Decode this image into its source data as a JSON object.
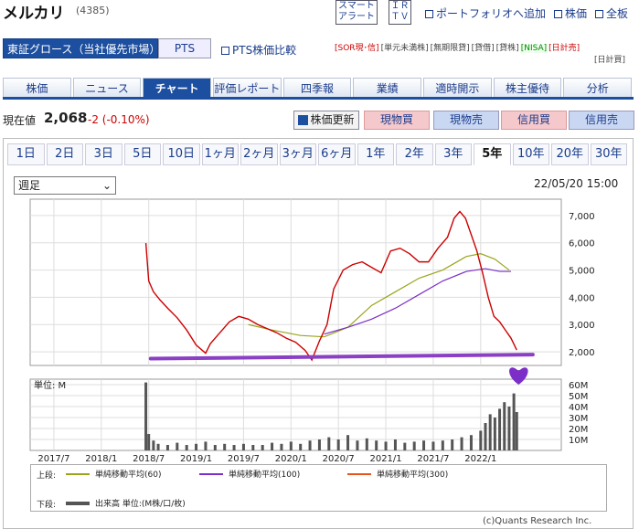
{
  "header": {
    "title": "メルカリ",
    "code": "(4385)",
    "alert_line1": "スマート",
    "alert_line2": "アラート",
    "ir_line1": "ＩＲ",
    "ir_line2": "ＴＶ",
    "links": [
      "ポートフォリオへ追加",
      "株価",
      "全板"
    ]
  },
  "market": {
    "name": "東証グロース（当社優先市場）",
    "pts": "PTS",
    "pts_compare": "PTS株価比較"
  },
  "tags": {
    "row1": [
      "[SOR現･信]",
      "[単元未満株]",
      "[無期限貸]",
      "[貸借]",
      "[貸株]",
      "[NISA]",
      "[日計売]"
    ],
    "row2": "[日計買]"
  },
  "tabs": [
    "株価",
    "ニュース",
    "チャート",
    "評価レポート",
    "四季報",
    "業績",
    "適時開示",
    "株主優待",
    "分析"
  ],
  "active_tab": "チャート",
  "price": {
    "label": "現在値",
    "value": "2,068",
    "change": "-2 (-0.10%)"
  },
  "buttons": {
    "update": "株価更新",
    "buy": "現物買",
    "sell": "現物売",
    "margin_buy": "信用買",
    "margin_sell": "信用売"
  },
  "periods": [
    "1日",
    "2日",
    "3日",
    "5日",
    "10日",
    "1ヶ月",
    "2ヶ月",
    "3ヶ月",
    "6ヶ月",
    "1年",
    "2年",
    "3年",
    "5年",
    "10年",
    "20年",
    "30年"
  ],
  "active_period": "5年",
  "select": {
    "value": "週足"
  },
  "datetime": "22/05/20 15:00",
  "chart_data": {
    "type": "line",
    "x_ticks": [
      "2017/7",
      "2018/1",
      "2018/7",
      "2019/1",
      "2019/7",
      "2020/1",
      "2020/7",
      "2021/1",
      "2021/7",
      "2022/1"
    ],
    "price_ticks": [
      "7,000",
      "6,000",
      "5,000",
      "4,000",
      "3,000",
      "2,000"
    ],
    "price_ylim": [
      1500,
      7600
    ],
    "volume_label": "単位: M",
    "volume_ticks": [
      "60M",
      "50M",
      "40M",
      "30M",
      "20M",
      "10M"
    ],
    "volume_ylim": [
      0,
      65
    ],
    "price_series": [
      [
        2018.47,
        5990
      ],
      [
        2018.5,
        4600
      ],
      [
        2018.55,
        4200
      ],
      [
        2018.62,
        3900
      ],
      [
        2018.7,
        3600
      ],
      [
        2018.8,
        3250
      ],
      [
        2018.9,
        2800
      ],
      [
        2019.0,
        2250
      ],
      [
        2019.1,
        1950
      ],
      [
        2019.15,
        2300
      ],
      [
        2019.25,
        2700
      ],
      [
        2019.35,
        3100
      ],
      [
        2019.45,
        3300
      ],
      [
        2019.55,
        3200
      ],
      [
        2019.65,
        3000
      ],
      [
        2019.75,
        2850
      ],
      [
        2019.85,
        2700
      ],
      [
        2019.95,
        2500
      ],
      [
        2020.05,
        2350
      ],
      [
        2020.15,
        2050
      ],
      [
        2020.22,
        1700
      ],
      [
        2020.3,
        2400
      ],
      [
        2020.38,
        3000
      ],
      [
        2020.45,
        4300
      ],
      [
        2020.55,
        5000
      ],
      [
        2020.65,
        5200
      ],
      [
        2020.75,
        5300
      ],
      [
        2020.85,
        5100
      ],
      [
        2020.95,
        4900
      ],
      [
        2021.05,
        5700
      ],
      [
        2021.15,
        5800
      ],
      [
        2021.25,
        5600
      ],
      [
        2021.35,
        5300
      ],
      [
        2021.45,
        5300
      ],
      [
        2021.55,
        5800
      ],
      [
        2021.65,
        6200
      ],
      [
        2021.72,
        6900
      ],
      [
        2021.78,
        7150
      ],
      [
        2021.84,
        6900
      ],
      [
        2021.9,
        6300
      ],
      [
        2021.96,
        5700
      ],
      [
        2022.02,
        4900
      ],
      [
        2022.08,
        4000
      ],
      [
        2022.14,
        3300
      ],
      [
        2022.2,
        3100
      ],
      [
        2022.26,
        2800
      ],
      [
        2022.32,
        2500
      ],
      [
        2022.38,
        2068
      ]
    ],
    "ma_series": [
      {
        "name": "単純移動平均(60)",
        "color": "#9aa51c",
        "points": [
          [
            2019.55,
            3000
          ],
          [
            2019.8,
            2800
          ],
          [
            2020.1,
            2600
          ],
          [
            2020.35,
            2550
          ],
          [
            2020.6,
            2900
          ],
          [
            2020.85,
            3700
          ],
          [
            2021.1,
            4200
          ],
          [
            2021.35,
            4700
          ],
          [
            2021.6,
            5000
          ],
          [
            2021.85,
            5500
          ],
          [
            2022.0,
            5600
          ],
          [
            2022.15,
            5400
          ],
          [
            2022.3,
            5000
          ]
        ]
      },
      {
        "name": "単純移動平均(100)",
        "color": "#7b2fc8",
        "points": [
          [
            2020.35,
            2650
          ],
          [
            2020.6,
            2900
          ],
          [
            2020.85,
            3200
          ],
          [
            2021.1,
            3600
          ],
          [
            2021.35,
            4100
          ],
          [
            2021.6,
            4600
          ],
          [
            2021.85,
            4950
          ],
          [
            2022.05,
            5050
          ],
          [
            2022.2,
            4950
          ],
          [
            2022.32,
            4950
          ]
        ]
      },
      {
        "name": "単純移動平均(300)",
        "color": "#e8541a",
        "points": []
      }
    ],
    "volume_series": [
      [
        2018.47,
        62
      ],
      [
        2018.5,
        15
      ],
      [
        2018.55,
        9
      ],
      [
        2018.6,
        6
      ],
      [
        2018.7,
        5
      ],
      [
        2018.8,
        7
      ],
      [
        2018.9,
        5
      ],
      [
        2019.0,
        6
      ],
      [
        2019.1,
        8
      ],
      [
        2019.2,
        5
      ],
      [
        2019.3,
        6
      ],
      [
        2019.4,
        5
      ],
      [
        2019.5,
        6
      ],
      [
        2019.6,
        5
      ],
      [
        2019.7,
        5
      ],
      [
        2019.8,
        7
      ],
      [
        2019.9,
        6
      ],
      [
        2020.0,
        8
      ],
      [
        2020.1,
        6
      ],
      [
        2020.2,
        9
      ],
      [
        2020.3,
        10
      ],
      [
        2020.4,
        12
      ],
      [
        2020.5,
        10
      ],
      [
        2020.6,
        14
      ],
      [
        2020.7,
        9
      ],
      [
        2020.8,
        11
      ],
      [
        2020.9,
        9
      ],
      [
        2021.0,
        8
      ],
      [
        2021.1,
        10
      ],
      [
        2021.2,
        7
      ],
      [
        2021.3,
        8
      ],
      [
        2021.4,
        9
      ],
      [
        2021.5,
        8
      ],
      [
        2021.6,
        9
      ],
      [
        2021.7,
        10
      ],
      [
        2021.8,
        12
      ],
      [
        2021.9,
        14
      ],
      [
        2022.0,
        18
      ],
      [
        2022.05,
        25
      ],
      [
        2022.1,
        33
      ],
      [
        2022.15,
        30
      ],
      [
        2022.2,
        38
      ],
      [
        2022.25,
        44
      ],
      [
        2022.3,
        40
      ],
      [
        2022.35,
        52
      ],
      [
        2022.38,
        35
      ]
    ],
    "support_line": [
      [
        2018.52,
        1750
      ],
      [
        2022.55,
        1900
      ]
    ],
    "legend_top_label": "上段:",
    "legend_bottom_label": "下段:",
    "volume_legend": "出来高 単位:(M株/口/枚)",
    "colors": {
      "price": "#cc0000",
      "volume": "#555555",
      "support": "#8a3fc4",
      "grid": "#dddddd"
    }
  },
  "copyright": "(c)Quants Research Inc."
}
